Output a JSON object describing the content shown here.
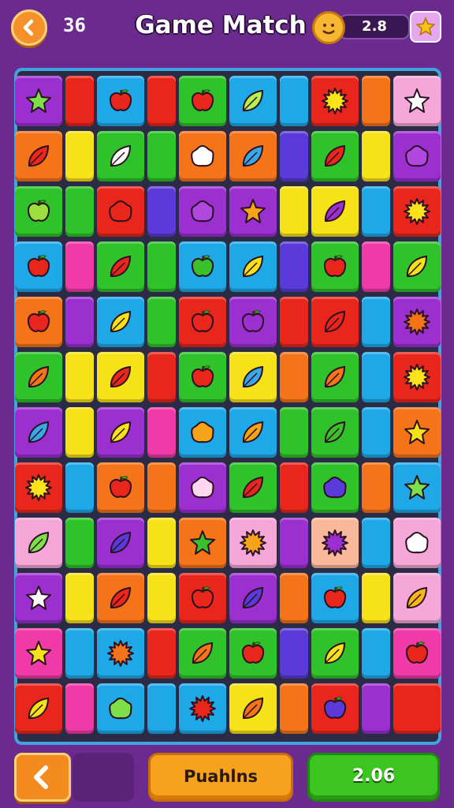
{
  "header": {
    "moves": "36",
    "title": "Game Match",
    "score": "2.8"
  },
  "footer": {
    "primary_label": "Puahlns",
    "score_label": "2.06"
  },
  "colors": {
    "purple": "#9b2fd0",
    "red": "#e8261c",
    "blue": "#1fa8e8",
    "green": "#2fc22a",
    "orange": "#f5741a",
    "yellow": "#f7e21a",
    "pink": "#f03aa8",
    "lightpink": "#f5a8d8",
    "peach": "#f9b89a",
    "indigo": "#5a3ad8"
  },
  "board": [
    [
      {
        "c": "purple",
        "i": "star",
        "ic": "#7de04a"
      },
      {
        "c": "red"
      },
      {
        "c": "blue",
        "i": "apple",
        "ic": "#e8261c"
      },
      {
        "c": "red"
      },
      {
        "c": "green",
        "i": "apple",
        "ic": "#e8261c"
      },
      {
        "c": "blue",
        "i": "leaf",
        "ic": "#b8f050"
      },
      {
        "c": "blue"
      },
      {
        "c": "red",
        "i": "burst",
        "ic": "#ffe31a"
      },
      {
        "c": "orange"
      },
      {
        "c": "lightpink",
        "i": "star",
        "ic": "#ffffff"
      }
    ],
    [
      {
        "c": "orange",
        "i": "leaf",
        "ic": "#e8261c"
      },
      {
        "c": "yellow"
      },
      {
        "c": "green",
        "i": "leaf",
        "ic": "#ffffff"
      },
      {
        "c": "green"
      },
      {
        "c": "orange",
        "i": "blob",
        "ic": "#ffffff"
      },
      {
        "c": "orange",
        "i": "leaf",
        "ic": "#3aa8e8"
      },
      {
        "c": "indigo"
      },
      {
        "c": "green",
        "i": "leaf",
        "ic": "#e8261c"
      },
      {
        "c": "yellow"
      },
      {
        "c": "purple",
        "i": "blob",
        "ic": "#b048e0"
      }
    ],
    [
      {
        "c": "green",
        "i": "apple",
        "ic": "#9be040"
      },
      {
        "c": "green"
      },
      {
        "c": "red",
        "i": "blob",
        "ic": "#e8261c"
      },
      {
        "c": "indigo"
      },
      {
        "c": "purple",
        "i": "blob",
        "ic": "#b048e0"
      },
      {
        "c": "purple",
        "i": "star",
        "ic": "#f5a41a"
      },
      {
        "c": "yellow"
      },
      {
        "c": "yellow",
        "i": "leaf",
        "ic": "#9b2fd0"
      },
      {
        "c": "blue"
      },
      {
        "c": "red",
        "i": "burst",
        "ic": "#ffe31a"
      }
    ],
    [
      {
        "c": "blue",
        "i": "apple",
        "ic": "#e8261c"
      },
      {
        "c": "pink"
      },
      {
        "c": "green",
        "i": "leaf",
        "ic": "#e8261c"
      },
      {
        "c": "green"
      },
      {
        "c": "blue",
        "i": "apple",
        "ic": "#3ac02a"
      },
      {
        "c": "blue",
        "i": "leaf",
        "ic": "#f7e21a"
      },
      {
        "c": "indigo"
      },
      {
        "c": "green",
        "i": "apple",
        "ic": "#e8261c"
      },
      {
        "c": "pink"
      },
      {
        "c": "green",
        "i": "leaf",
        "ic": "#f7e21a"
      }
    ],
    [
      {
        "c": "orange",
        "i": "apple",
        "ic": "#e8261c"
      },
      {
        "c": "purple"
      },
      {
        "c": "blue",
        "i": "leaf",
        "ic": "#f7e21a"
      },
      {
        "c": "green"
      },
      {
        "c": "red",
        "i": "apple",
        "ic": "#e8261c"
      },
      {
        "c": "purple",
        "i": "apple",
        "ic": "#9b2fd0"
      },
      {
        "c": "red"
      },
      {
        "c": "red",
        "i": "leaf",
        "ic": "#e8261c"
      },
      {
        "c": "blue"
      },
      {
        "c": "purple",
        "i": "burst",
        "ic": "#f5741a"
      }
    ],
    [
      {
        "c": "green",
        "i": "leaf",
        "ic": "#f5741a"
      },
      {
        "c": "yellow"
      },
      {
        "c": "yellow",
        "i": "leaf",
        "ic": "#e8261c"
      },
      {
        "c": "red"
      },
      {
        "c": "green",
        "i": "apple",
        "ic": "#e8261c"
      },
      {
        "c": "yellow",
        "i": "leaf",
        "ic": "#3aa8e8"
      },
      {
        "c": "orange"
      },
      {
        "c": "green",
        "i": "leaf",
        "ic": "#f5741a"
      },
      {
        "c": "blue"
      },
      {
        "c": "red",
        "i": "burst",
        "ic": "#ffe31a"
      }
    ],
    [
      {
        "c": "purple",
        "i": "leaf",
        "ic": "#3aa8e8"
      },
      {
        "c": "yellow"
      },
      {
        "c": "purple",
        "i": "leaf",
        "ic": "#f7e21a"
      },
      {
        "c": "pink"
      },
      {
        "c": "blue",
        "i": "blob",
        "ic": "#f5a41a"
      },
      {
        "c": "blue",
        "i": "leaf",
        "ic": "#f5a41a"
      },
      {
        "c": "green"
      },
      {
        "c": "green",
        "i": "leaf",
        "ic": "#3ac02a"
      },
      {
        "c": "blue"
      },
      {
        "c": "orange",
        "i": "star",
        "ic": "#f7e21a"
      }
    ],
    [
      {
        "c": "red",
        "i": "burst",
        "ic": "#ffe31a"
      },
      {
        "c": "blue"
      },
      {
        "c": "orange",
        "i": "apple",
        "ic": "#e8261c"
      },
      {
        "c": "orange"
      },
      {
        "c": "purple",
        "i": "blob",
        "ic": "#ffd8f0"
      },
      {
        "c": "green",
        "i": "leaf",
        "ic": "#e8261c"
      },
      {
        "c": "red"
      },
      {
        "c": "green",
        "i": "blob",
        "ic": "#5a3ad8"
      },
      {
        "c": "orange"
      },
      {
        "c": "blue",
        "i": "star",
        "ic": "#7de04a"
      }
    ],
    [
      {
        "c": "lightpink",
        "i": "leaf",
        "ic": "#7de04a"
      },
      {
        "c": "green"
      },
      {
        "c": "purple",
        "i": "leaf",
        "ic": "#5a3ad8"
      },
      {
        "c": "yellow"
      },
      {
        "c": "orange",
        "i": "star",
        "ic": "#3ac02a"
      },
      {
        "c": "lightpink",
        "i": "burst",
        "ic": "#f5a41a"
      },
      {
        "c": "purple"
      },
      {
        "c": "peach",
        "i": "burst",
        "ic": "#9b2fd0"
      },
      {
        "c": "blue"
      },
      {
        "c": "lightpink",
        "i": "blob",
        "ic": "#ffffff"
      }
    ],
    [
      {
        "c": "purple",
        "i": "star",
        "ic": "#ffffff"
      },
      {
        "c": "yellow"
      },
      {
        "c": "orange",
        "i": "leaf",
        "ic": "#e8261c"
      },
      {
        "c": "yellow"
      },
      {
        "c": "red",
        "i": "apple",
        "ic": "#e8261c"
      },
      {
        "c": "purple",
        "i": "leaf",
        "ic": "#5a3ad8"
      },
      {
        "c": "orange"
      },
      {
        "c": "blue",
        "i": "apple",
        "ic": "#e8261c"
      },
      {
        "c": "yellow"
      },
      {
        "c": "lightpink",
        "i": "leaf",
        "ic": "#f7b71a"
      }
    ],
    [
      {
        "c": "pink",
        "i": "star",
        "ic": "#f7e21a"
      },
      {
        "c": "blue"
      },
      {
        "c": "blue",
        "i": "burst",
        "ic": "#f5741a"
      },
      {
        "c": "red"
      },
      {
        "c": "green",
        "i": "leaf",
        "ic": "#f5741a"
      },
      {
        "c": "green",
        "i": "apple",
        "ic": "#e8261c"
      },
      {
        "c": "indigo"
      },
      {
        "c": "green",
        "i": "leaf",
        "ic": "#f7e21a"
      },
      {
        "c": "blue"
      },
      {
        "c": "pink",
        "i": "apple",
        "ic": "#e8261c"
      }
    ],
    [
      {
        "c": "red",
        "i": "leaf",
        "ic": "#f7e21a"
      },
      {
        "c": "pink"
      },
      {
        "c": "blue",
        "i": "blob",
        "ic": "#7de04a"
      },
      {
        "c": "blue"
      },
      {
        "c": "blue",
        "i": "burst",
        "ic": "#e8261c"
      },
      {
        "c": "yellow",
        "i": "leaf",
        "ic": "#f5741a"
      },
      {
        "c": "orange"
      },
      {
        "c": "red",
        "i": "apple",
        "ic": "#5a3ad8"
      },
      {
        "c": "purple"
      },
      {
        "c": "red"
      }
    ]
  ]
}
